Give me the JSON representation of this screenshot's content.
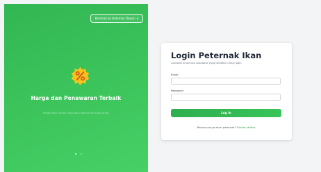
{
  "left_panel": {
    "back_button_label": "Kembali ke Halaman Depan",
    "back_button_chevron": "▾",
    "promo_title": "Harga dan Penawaran Terbaik",
    "promo_description": "Harga lebih murah daripada supermarket lokal Anda.",
    "promo_icon": "percent-badge-icon",
    "carousel_slide_count": 2,
    "carousel_active_index": 0
  },
  "login": {
    "title": "Login Peternak Ikan",
    "subtitle": "Gunakan email dan password yang terdaftar untuk login",
    "email_label": "Email",
    "email_value": "",
    "password_label": "Password",
    "password_value": "",
    "submit_label": "Log In",
    "register_prompt": "Belum punya akun peternak?",
    "register_link": "Silakan daftar."
  },
  "colors": {
    "brand_green": "#3dc55c",
    "button_green": "#2fae4e",
    "badge_yellow": "#f6c21c"
  }
}
